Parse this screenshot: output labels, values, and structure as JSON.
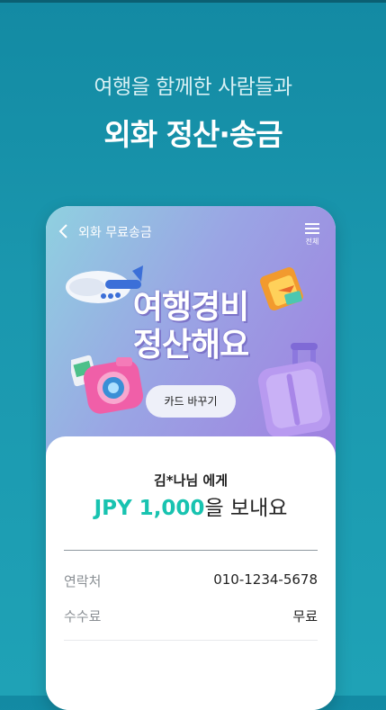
{
  "headline": {
    "subtitle": "여행을 함께한 사람들과",
    "title": "외화 정산·송금"
  },
  "nav": {
    "title": "외화 무료송금",
    "menu_label": "전체"
  },
  "banner": {
    "title_line1": "여행경비",
    "title_line2": "정산해요",
    "card_button": "카드 바꾸기"
  },
  "transfer": {
    "recipient": "김*나님 에게",
    "amount": "JPY 1,000",
    "amount_suffix": "을 보내요",
    "contact_label": "연락처",
    "contact_value": "010-1234-5678",
    "fee_label": "수수료",
    "fee_value": "무료"
  },
  "colors": {
    "accent": "#18c3b0",
    "background": "#1a97ae"
  }
}
